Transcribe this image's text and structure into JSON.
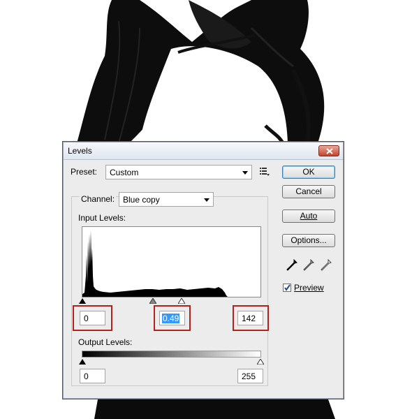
{
  "dialog": {
    "title": "Levels",
    "preset_label": "Preset:",
    "preset_value": "Custom",
    "channel_label": "Channel:",
    "channel_value": "Blue copy",
    "input_levels_label": "Input Levels:",
    "input_black": "0",
    "input_gamma": "0.49",
    "input_white": "142",
    "output_levels_label": "Output Levels:",
    "output_black": "0",
    "output_white": "255",
    "buttons": {
      "ok": "OK",
      "cancel": "Cancel",
      "auto": "Auto",
      "options": "Options..."
    },
    "preview_label": "Preview",
    "preview_checked": true
  },
  "icons": {
    "close": "close-icon",
    "preset_menu": "preset-options-icon",
    "black_eyedropper": "black-eyedropper-icon",
    "gray_eyedropper": "gray-eyedropper-icon",
    "white_eyedropper": "white-eyedropper-icon"
  },
  "colors": {
    "highlight_box": "#b3221f",
    "selection": "#3399ff",
    "dialog_bg": "#ececec"
  }
}
